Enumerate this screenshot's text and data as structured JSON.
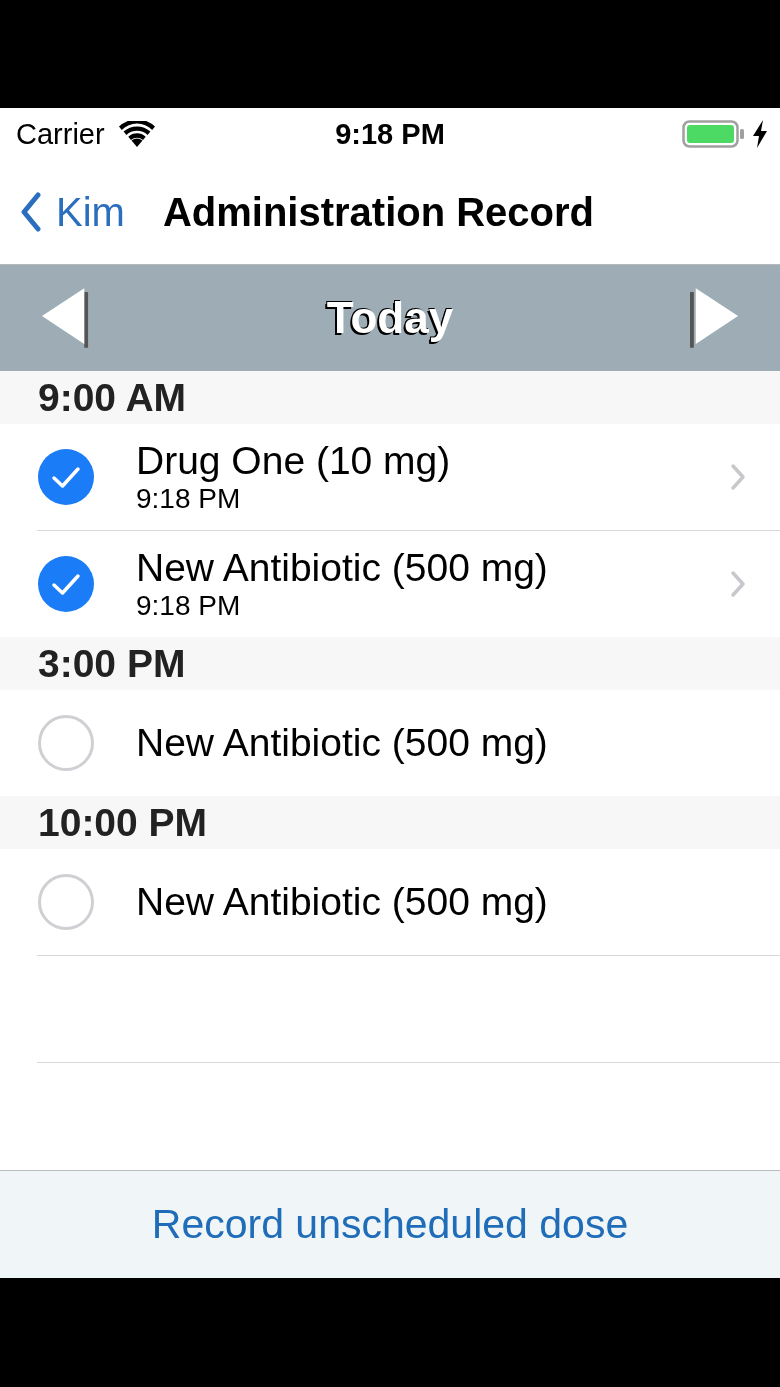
{
  "status_bar": {
    "carrier": "Carrier",
    "time": "9:18 PM",
    "charging": true
  },
  "nav_bar": {
    "back_label": "Kim",
    "title": "Administration Record"
  },
  "day_selector": {
    "label": "Today"
  },
  "sections": [
    {
      "time": "9:00 AM",
      "doses": [
        {
          "name": "Drug One (10 mg)",
          "given_time": "9:18 PM",
          "checked": true,
          "disclosure": true
        },
        {
          "name": "New Antibiotic (500 mg)",
          "given_time": "9:18 PM",
          "checked": true,
          "disclosure": true
        }
      ]
    },
    {
      "time": "3:00 PM",
      "doses": [
        {
          "name": "New Antibiotic (500 mg)",
          "checked": false,
          "disclosure": false
        }
      ]
    },
    {
      "time": "10:00 PM",
      "doses": [
        {
          "name": "New Antibiotic (500 mg)",
          "checked": false,
          "disclosure": false
        }
      ]
    }
  ],
  "action": {
    "label": "Record unscheduled dose"
  }
}
